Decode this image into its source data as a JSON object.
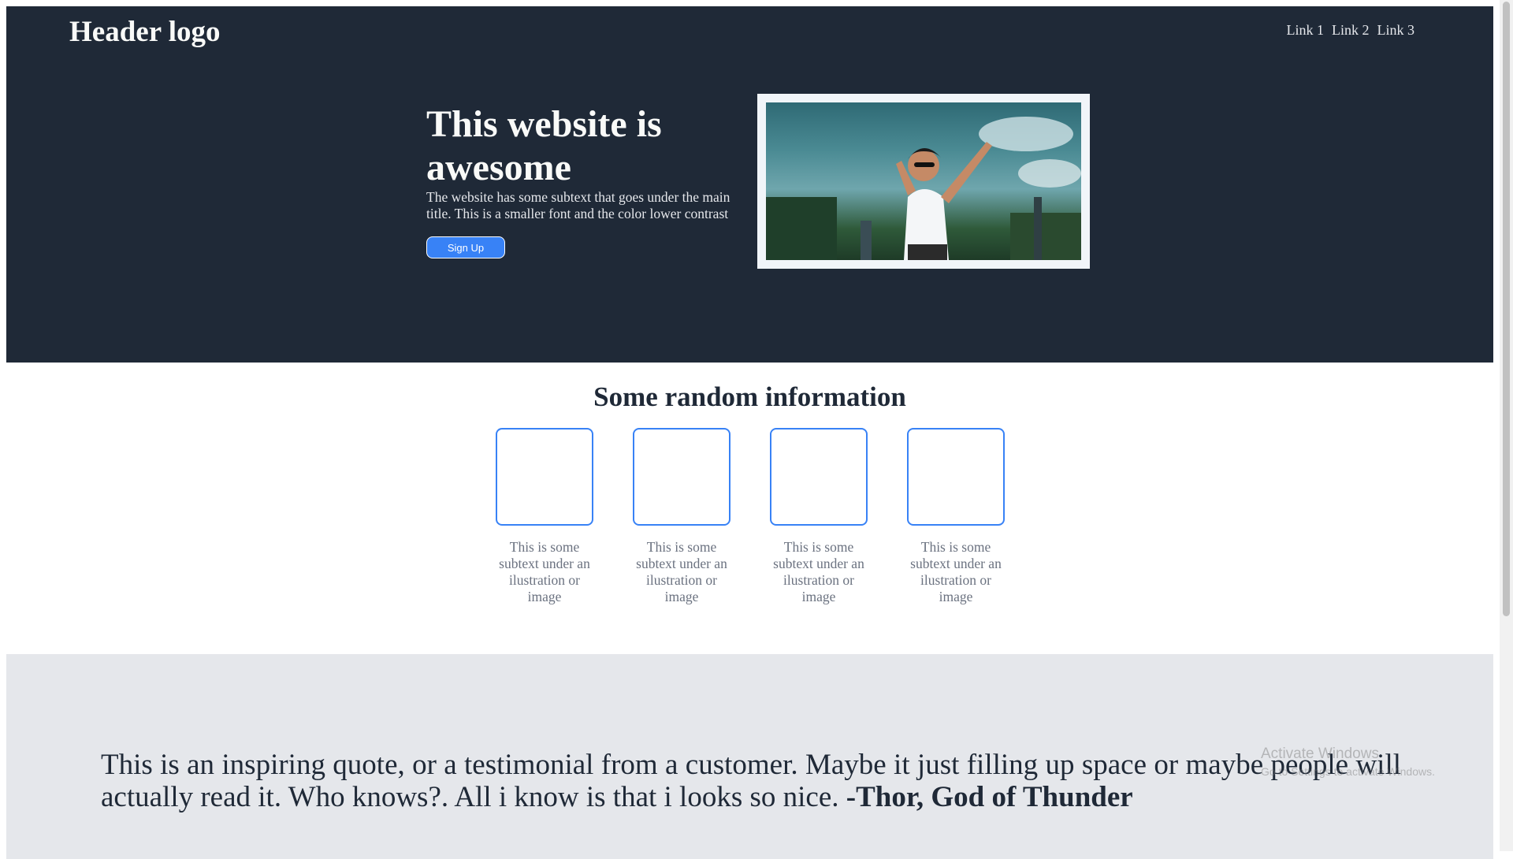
{
  "header": {
    "logo": "Header logo",
    "nav": [
      "Link 1",
      "Link 2",
      "Link 3"
    ]
  },
  "hero": {
    "title": "This website is awesome",
    "subtext": "The website has some subtext that goes under the main title. This is a smaller font and the color lower contrast",
    "button_label": "Sign Up"
  },
  "info": {
    "title": "Some random information",
    "cards": [
      {
        "text": "This is some subtext under an ilustration or image"
      },
      {
        "text": "This is some subtext under an ilustration or image"
      },
      {
        "text": "This is some subtext under an ilustration or image"
      },
      {
        "text": "This is some subtext under an ilustration or image"
      }
    ]
  },
  "quote": {
    "text": "This is an inspiring quote, or a testimonial from a customer. Maybe it just filling up space or maybe people will actually read it. Who knows?. All i know is that i looks so nice.",
    "author": "-Thor, God of Thunder"
  },
  "watermark": {
    "line1": "Activate Windows",
    "line2": "Go to Settings to activate Windows."
  },
  "colors": {
    "hero_bg": "#1f2937",
    "accent": "#3882f6",
    "quote_bg": "#e5e7eb"
  }
}
